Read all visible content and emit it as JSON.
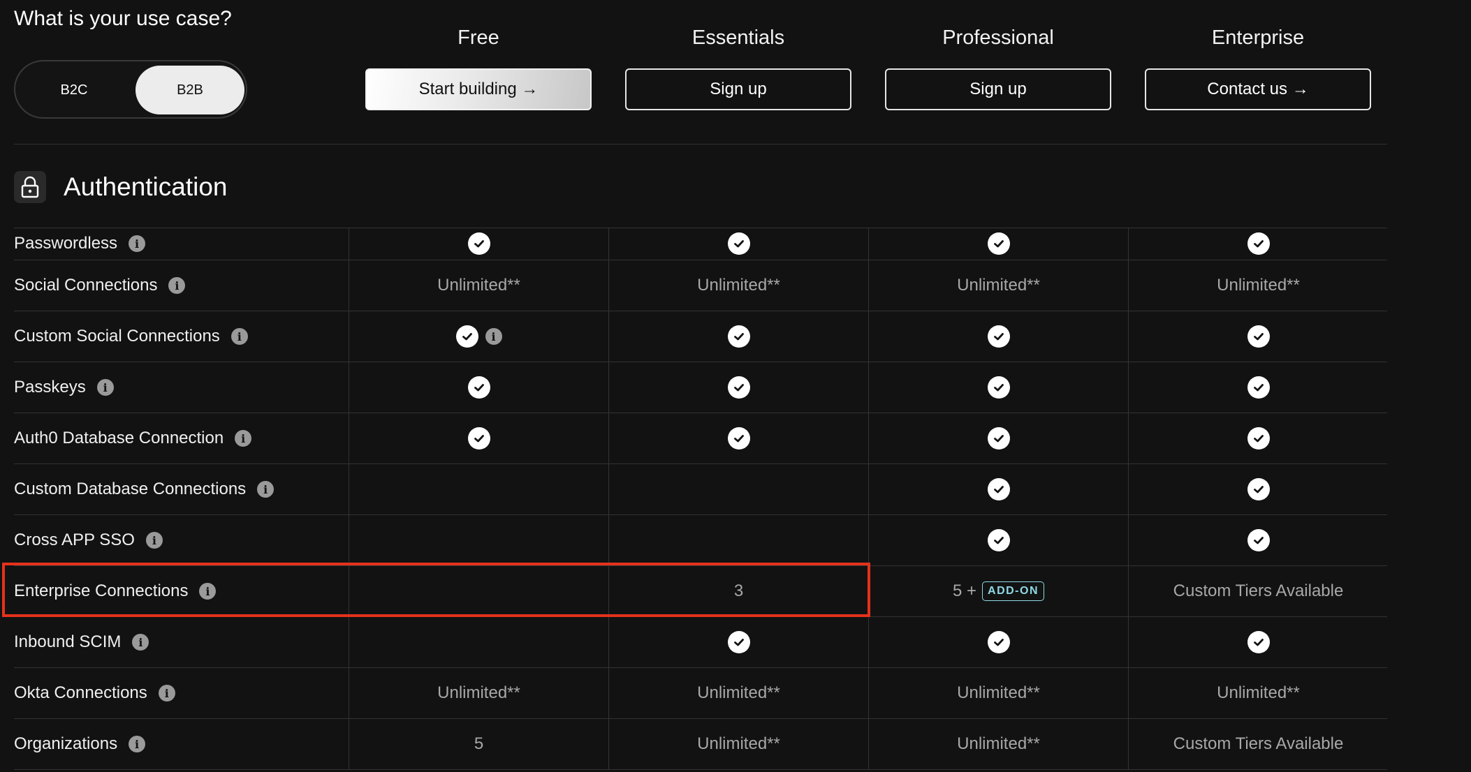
{
  "header": {
    "question": "What is your use case?",
    "toggle": {
      "options": [
        "B2C",
        "B2B"
      ],
      "selected": "B2B"
    }
  },
  "plans": [
    {
      "name": "Free",
      "button": "Start building →",
      "primary": true
    },
    {
      "name": "Essentials",
      "button": "Sign up"
    },
    {
      "name": "Professional",
      "button": "Sign up"
    },
    {
      "name": "Enterprise",
      "button": "Contact us →"
    }
  ],
  "section": {
    "title": "Authentication",
    "icon": "lock-icon"
  },
  "rows": [
    {
      "label": "Passwordless",
      "cells": [
        "check",
        "check",
        "check",
        "check"
      ]
    },
    {
      "label": "Social Connections",
      "cells": [
        "Unlimited**",
        "Unlimited**",
        "Unlimited**",
        "Unlimited**"
      ]
    },
    {
      "label": "Custom Social Connections",
      "cells": [
        "check+info",
        "check",
        "check",
        "check"
      ]
    },
    {
      "label": "Passkeys",
      "cells": [
        "check",
        "check",
        "check",
        "check"
      ]
    },
    {
      "label": "Auth0 Database Connection",
      "cells": [
        "check",
        "check",
        "check",
        "check"
      ]
    },
    {
      "label": "Custom Database Connections",
      "cells": [
        "",
        "",
        "check",
        "check"
      ]
    },
    {
      "label": "Cross APP SSO",
      "cells": [
        "",
        "",
        "check",
        "check"
      ]
    },
    {
      "label": "Enterprise Connections",
      "cells": [
        "",
        "3",
        "5 +|ADD-ON",
        "Custom Tiers Available"
      ]
    },
    {
      "label": "Inbound SCIM",
      "cells": [
        "",
        "check",
        "check",
        "check"
      ]
    },
    {
      "label": "Okta Connections",
      "cells": [
        "Unlimited**",
        "Unlimited**",
        "Unlimited**",
        "Unlimited**"
      ]
    },
    {
      "label": "Organizations",
      "cells": [
        "5",
        "Unlimited**",
        "Unlimited**",
        "Custom Tiers Available"
      ]
    }
  ],
  "colors": {
    "background": "#121212",
    "highlight": "#e5321b",
    "addon": "#8fd9e6"
  }
}
